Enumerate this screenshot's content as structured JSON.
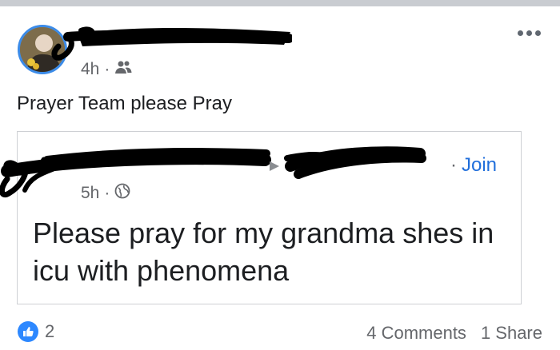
{
  "post": {
    "time": "4h",
    "audience_icon": "friends-icon",
    "text": "Prayer Team please Pray"
  },
  "shared_post": {
    "join_separator": "·",
    "join_label": "Join",
    "time": "5h",
    "audience_icon": "globe-icon",
    "text": "Please pray for my grandma shes in icu with phenomena"
  },
  "footer": {
    "like_count": "2",
    "comments": "4 Comments",
    "shares": "1 Share"
  },
  "colors": {
    "link": "#216fdb",
    "like_badge": "#2d88ff",
    "avatar_ring": "#3b8be8",
    "meta_text": "#65676b"
  }
}
